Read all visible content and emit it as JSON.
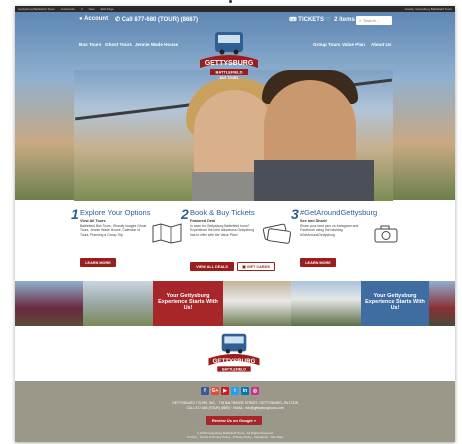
{
  "admin_bar": {
    "items": [
      "Gettysburg Battlefield Tours",
      "Customize",
      "0",
      "New",
      "Edit Page"
    ],
    "right": "Howdy, Gettysburg Battlefield Tours"
  },
  "topbar": {
    "account": "Account",
    "call": "Call 877-680 (TOUR) (8687)",
    "tickets": "TICKETS",
    "cart": "2 items",
    "search_placeholder": "Search ..."
  },
  "nav": {
    "left": [
      "Bus Tours",
      "Ghost Tours",
      "Jennie Wade House"
    ],
    "right": [
      "Group Tours",
      "Value Plan",
      "About Us"
    ]
  },
  "logo": {
    "line1": "GETTYSBURG",
    "line2": "BATTLEFIELD",
    "line3": "BUS TOURS"
  },
  "features": [
    {
      "num": "1",
      "title": "Explore Your Options",
      "subtitle": "View All Tours",
      "desc": "Battlefield Bus Tours, Ghostly Images Ghost Tours, Jennie Wade House, Calendar of Tours, Planning a Group Trip",
      "button": "LEARN MORE"
    },
    {
      "num": "2",
      "title": "Book & Buy Tickets",
      "subtitle": "Featured Deal",
      "desc": "In town for Gettysburg Battlefield tours? Experience the best attractions Gettysburg has to offer with the Value Plan!",
      "button": "VIEW ALL DEALS",
      "button2": "GIFT CARDS"
    },
    {
      "num": "3",
      "title": "#GetAroundGettysburg",
      "subtitle": "See and Share!",
      "desc": "Share your best pics on Instagram and Facebook using the hashtag #GetAroundGettysburg",
      "button": "LEARN MORE"
    }
  ],
  "strip": {
    "caption1": "Your Gettysburg Experience Starts With Us!",
    "caption2": "Your Gettysburg Experience Starts With Us!"
  },
  "footer": {
    "social": [
      "f",
      "G+",
      "▶",
      "t",
      "in",
      "◎"
    ],
    "address": "GETTYSBURG TOURS, INC. · 778 BALTIMORE STREET, GETTYSBURG, PA 17325",
    "contact": "CALL 877-680 (TOUR) (8687) · EMAIL: info@gettysburgtours.com",
    "review": "Review Us on Google »",
    "copyright": "© 2019 Gettysburg Battlefield Tours · All Rights Reserved",
    "links": "Privacy · Terms & Privacy Policy · Privacy Policy · Disclaimer · Site Map"
  },
  "colors": {
    "brand_red": "#9c1d1d",
    "brand_blue": "#2f5f93",
    "footer_gray": "#9b988a"
  }
}
